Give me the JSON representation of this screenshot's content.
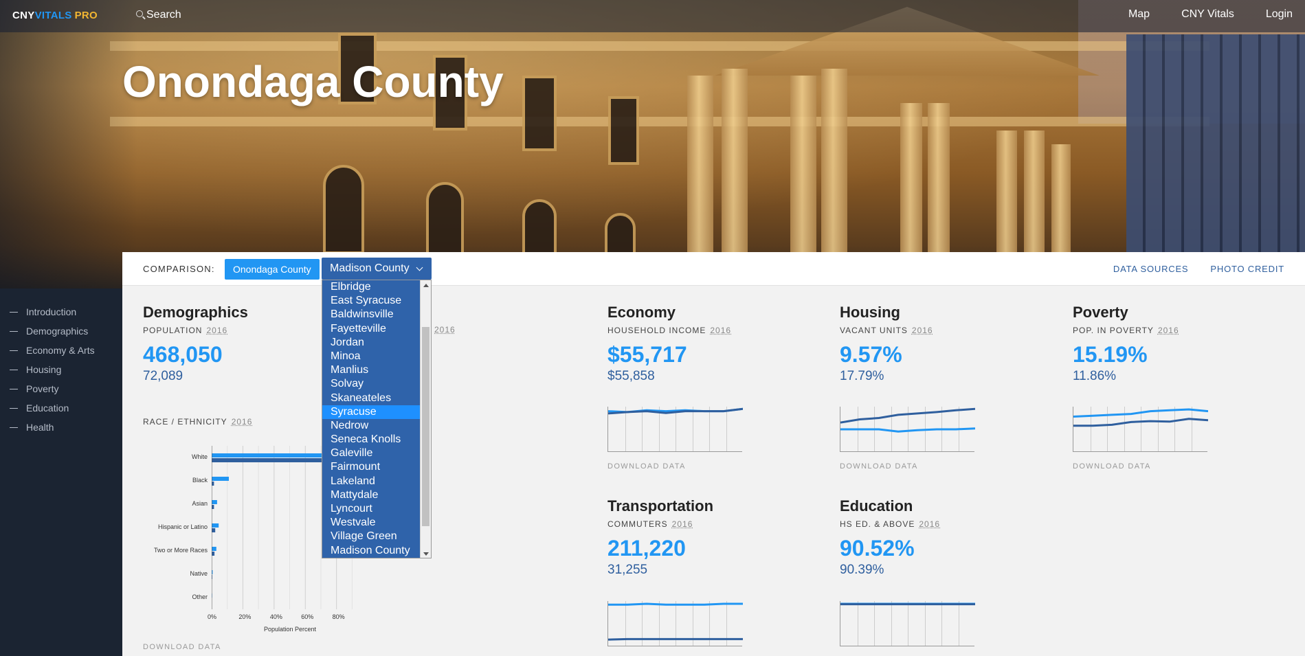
{
  "nav": {
    "brand": {
      "part1": "CNY",
      "part2": "VITALS",
      "part3": "PRO"
    },
    "search_label": "Search",
    "links": [
      "Map",
      "CNY Vitals",
      "Login"
    ]
  },
  "page": {
    "title": "Onondaga County"
  },
  "sidenav": [
    "Introduction",
    "Demographics",
    "Economy & Arts",
    "Housing",
    "Poverty",
    "Education",
    "Health"
  ],
  "comparison": {
    "label": "COMPARISON:",
    "primary": "Onondaga County",
    "selected": "Madison County",
    "options": [
      "Elbridge",
      "East Syracuse",
      "Baldwinsville",
      "Fayetteville",
      "Jordan",
      "Minoa",
      "Manlius",
      "Solvay",
      "Skaneateles",
      "Syracuse",
      "Nedrow",
      "Seneca Knolls",
      "Galeville",
      "Fairmount",
      "Lakeland",
      "Mattydale",
      "Lyncourt",
      "Westvale",
      "Village Green",
      "Madison County"
    ],
    "highlighted": "Syracuse",
    "links": [
      "DATA SOURCES",
      "PHOTO CREDIT"
    ]
  },
  "cards": {
    "demographics": {
      "title": "Demographics",
      "label": "POPULATION",
      "year": "2016",
      "value": "468,050",
      "compare": "72,089",
      "hidden_year": "2016"
    },
    "economy": {
      "title": "Economy",
      "label": "HOUSEHOLD INCOME",
      "year": "2016",
      "value": "$55,717",
      "compare": "$55,858",
      "download": "DOWNLOAD DATA"
    },
    "housing": {
      "title": "Housing",
      "label": "VACANT UNITS",
      "year": "2016",
      "value": "9.57%",
      "compare": "17.79%",
      "download": "DOWNLOAD DATA"
    },
    "poverty": {
      "title": "Poverty",
      "label": "POP. IN POVERTY",
      "year": "2016",
      "value": "15.19%",
      "compare": "11.86%",
      "download": "DOWNLOAD DATA"
    },
    "transportation": {
      "title": "Transportation",
      "label": "COMMUTERS",
      "year": "2016",
      "value": "211,220",
      "compare": "31,255"
    },
    "education": {
      "title": "Education",
      "label": "HS ED. & ABOVE",
      "year": "2016",
      "value": "90.52%",
      "compare": "90.39%"
    }
  },
  "race": {
    "label": "RACE / ETHNICITY",
    "year": "2016",
    "download": "DOWNLOAD DATA"
  },
  "chart_data": {
    "type": "bar",
    "orientation": "horizontal",
    "categories": [
      "White",
      "Black",
      "Asian",
      "Hispanic or Latino",
      "Two or More Races",
      "Native",
      "Other"
    ],
    "series": [
      {
        "values": [
          78,
          11,
          3.5,
          4.5,
          3,
          0.6,
          0.3
        ],
        "color": "#2196f3"
      },
      {
        "values": [
          92,
          1.5,
          1.5,
          2.3,
          1.8,
          0.4,
          0.2
        ],
        "color": "#2f5f9e"
      }
    ],
    "xlabel": "Population Percent",
    "xticks": [
      "0%",
      "20%",
      "40%",
      "60%",
      "80%"
    ],
    "xlim": [
      0,
      96
    ],
    "grid": true
  },
  "sparklines": {
    "economy": {
      "series": [
        [
          0.1,
          0.12,
          0.08,
          0.1,
          0.08,
          0.1,
          0.1,
          0.05
        ],
        [
          0.15,
          0.12,
          0.1,
          0.14,
          0.1,
          0.1,
          0.1,
          0.05
        ]
      ],
      "colors": [
        "#2196f3",
        "#2f5f9e"
      ]
    },
    "housing": {
      "series": [
        [
          0.5,
          0.5,
          0.5,
          0.55,
          0.52,
          0.5,
          0.5,
          0.48
        ],
        [
          0.35,
          0.28,
          0.25,
          0.18,
          0.15,
          0.12,
          0.08,
          0.05
        ]
      ],
      "colors": [
        "#2196f3",
        "#2f5f9e"
      ]
    },
    "poverty": {
      "series": [
        [
          0.22,
          0.2,
          0.18,
          0.16,
          0.1,
          0.08,
          0.06,
          0.1
        ],
        [
          0.42,
          0.42,
          0.4,
          0.34,
          0.32,
          0.33,
          0.27,
          0.3
        ]
      ],
      "colors": [
        "#2196f3",
        "#2f5f9e"
      ]
    },
    "transportation": {
      "series": [
        [
          0.08,
          0.08,
          0.06,
          0.08,
          0.08,
          0.08,
          0.06,
          0.06
        ],
        [
          0.85,
          0.84,
          0.84,
          0.84,
          0.84,
          0.84,
          0.84,
          0.84
        ]
      ],
      "colors": [
        "#2196f3",
        "#2f5f9e"
      ]
    },
    "education": {
      "series": [
        [
          0.06,
          0.06,
          0.06,
          0.06,
          0.06,
          0.06,
          0.06,
          0.06
        ],
        [
          0.07,
          0.07,
          0.07,
          0.07,
          0.07,
          0.07,
          0.07,
          0.07
        ]
      ],
      "colors": [
        "#2196f3",
        "#2f5f9e"
      ]
    }
  }
}
